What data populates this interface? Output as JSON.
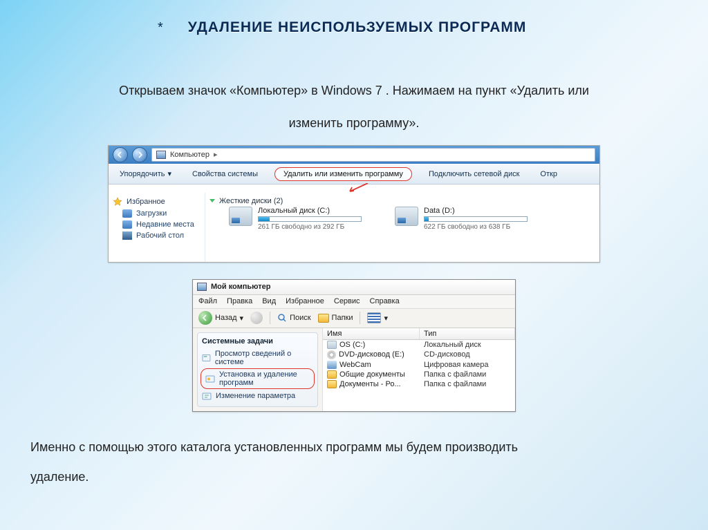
{
  "bullet": "*",
  "heading": "УДАЛЕНИЕ НЕИСПОЛЬЗУЕМЫХ ПРОГРАММ",
  "subtitle_line1": "Открываем значок «Компьютер» в Windows 7 . Нажимаем на пункт «Удалить или",
  "subtitle_line2": "изменить программу».",
  "win7": {
    "breadcrumb": "Компьютер",
    "chev": "▸",
    "toolbar": {
      "organize": "Упорядочить",
      "dd": "▾",
      "props": "Свойства системы",
      "uninstall": "Удалить или изменить программу",
      "mapdrive": "Подключить сетевой диск",
      "open": "Откр"
    },
    "sidebar": {
      "fav": "Избранное",
      "downloads": "Загрузки",
      "recent": "Недавние места",
      "desktop": "Рабочий стол"
    },
    "group": "Жесткие диски (2)",
    "diskC": {
      "name": "Локальный диск (C:)",
      "info": "261 ГБ свободно из 292 ГБ",
      "fill": "11%"
    },
    "diskD": {
      "name": "Data (D:)",
      "info": "622 ГБ свободно из 638 ГБ",
      "fill": "4%"
    }
  },
  "xp": {
    "title": "Мой компьютер",
    "menu": {
      "file": "Файл",
      "edit": "Правка",
      "view": "Вид",
      "fav": "Избранное",
      "tools": "Сервис",
      "help": "Справка"
    },
    "tool": {
      "back": "Назад",
      "dd": "▾",
      "search": "Поиск",
      "folders": "Папки"
    },
    "panel": {
      "header": "Системные задачи",
      "task1": "Просмотр сведений о системе",
      "task2a": "Установка и удаление",
      "task2b": "программ",
      "task3": "Изменение параметра"
    },
    "cols": {
      "name": "Имя",
      "type": "Тип"
    },
    "rows": [
      {
        "icon": "disk",
        "name": "OS (C:)",
        "type": "Локальный диск"
      },
      {
        "icon": "cd",
        "name": "DVD-дисковод (E:)",
        "type": "CD-дисковод"
      },
      {
        "icon": "cam",
        "name": "WebCam",
        "type": "Цифровая камера"
      },
      {
        "icon": "folder",
        "name": "Общие документы",
        "type": "Папка с файлами"
      },
      {
        "icon": "folder",
        "name": "Документы - Ро...",
        "type": "Папка с файлами"
      }
    ]
  },
  "conclusion_l1": "Именно с помощью этого каталога установленных программ мы будем производить",
  "conclusion_l2": "удаление."
}
